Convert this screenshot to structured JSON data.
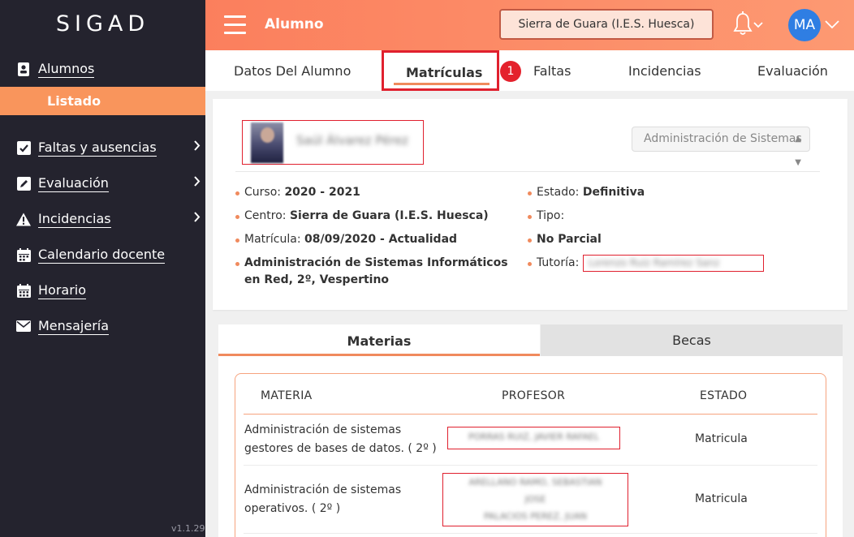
{
  "sidebar": {
    "brand": "SIGAD",
    "items": [
      {
        "label": "Alumnos",
        "icon": "student-card-icon"
      },
      {
        "label": "Faltas y ausencias",
        "icon": "checkbox-icon"
      },
      {
        "label": "Evaluación",
        "icon": "edit-icon"
      },
      {
        "label": "Incidencias",
        "icon": "warning-icon"
      },
      {
        "label": "Calendario docente",
        "icon": "calendar-icon"
      },
      {
        "label": "Horario",
        "icon": "schedule-icon"
      },
      {
        "label": "Mensajería",
        "icon": "envelope-icon"
      }
    ],
    "sub_item": "Listado",
    "version": "v1.1.29"
  },
  "header": {
    "title": "Alumno",
    "center": "Sierra de Guara (I.E.S. Huesca)",
    "avatar": "MA",
    "accent_color": "#fb7f5d"
  },
  "tabs": {
    "items": [
      "Datos Del Alumno",
      "Matrículas",
      "Faltas",
      "Incidencias",
      "Evaluación"
    ],
    "active": "Matrículas",
    "step_badge": "1"
  },
  "student": {
    "name": "Saúl Álvarez Pérez",
    "ciclo_select": "Administración de Sistemas",
    "left": [
      {
        "label": "Curso: ",
        "value": "2020 - 2021"
      },
      {
        "label": "Centro: ",
        "value": "Sierra de Guara (I.E.S. Huesca)"
      },
      {
        "label": "Matrícula: ",
        "value": "08/09/2020 - Actualidad"
      }
    ],
    "ciclo_full": "Administración de Sistemas Informáticos en Red, 2º, Vespertino",
    "right": [
      {
        "label": "Estado: ",
        "value": "Definitiva"
      },
      {
        "label": "Tipo: ",
        "value": ""
      }
    ],
    "parcial": "No Parcial",
    "tutoria_label": "Tutoría: ",
    "tutoria_value": "Lorenzo Ruiz Ramírez Sanz"
  },
  "lower_tabs": {
    "materias": "Materias",
    "becas": "Becas"
  },
  "table": {
    "headers": [
      "MATERIA",
      "PROFESOR",
      "ESTADO"
    ],
    "rows": [
      {
        "materia_line1": "Administración de sistemas",
        "materia_line2": "gestores de bases de datos. ( 2º )",
        "profesores": [
          "PORRAS RUIZ, JAVIER RAFAEL"
        ],
        "estado": "Matricula"
      },
      {
        "materia_line1": "Administración de sistemas",
        "materia_line2": "operativos. ( 2º )",
        "profesores": [
          "ARELLANO RAMO, SEBASTIAN",
          "JOSE",
          "PALACIOS PEREZ, JUAN"
        ],
        "estado": "Matricula"
      }
    ]
  }
}
